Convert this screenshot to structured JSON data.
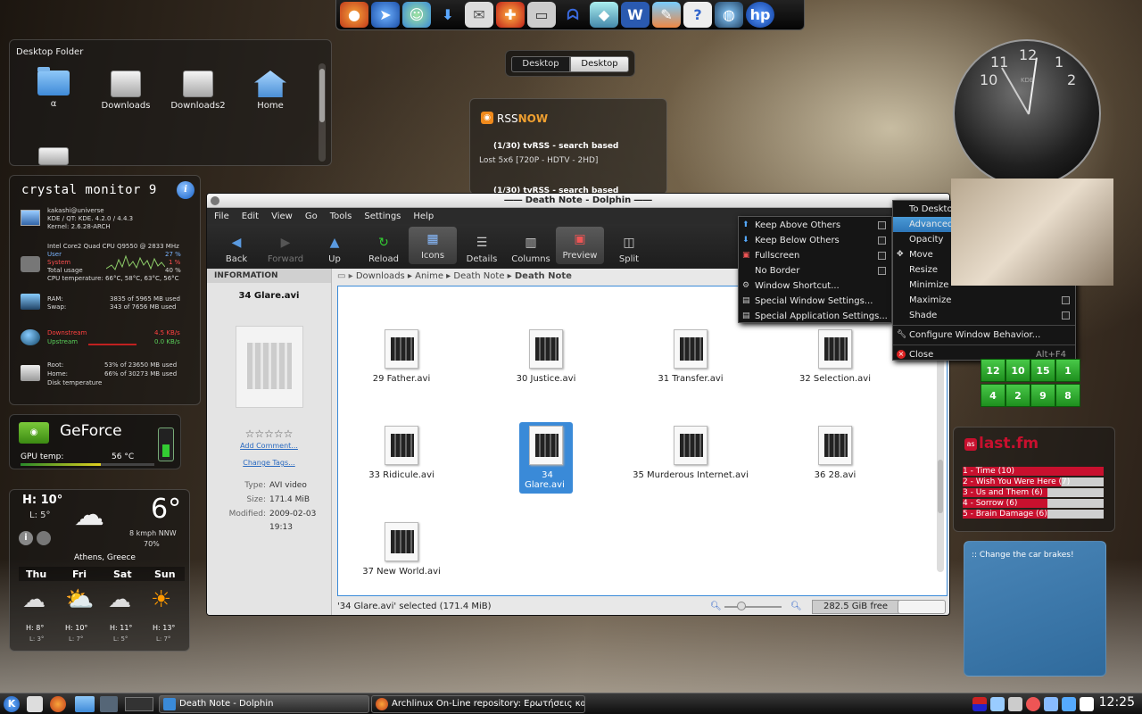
{
  "dock": {
    "icons": [
      "firefox-icon",
      "compass-icon",
      "messenger-icon",
      "download-icon",
      "mail-icon",
      "rescue-icon",
      "monitor-icon",
      "pacman-icon",
      "cube-icon",
      "word-icon",
      "paint-icon",
      "help-icon",
      "globe-icon",
      "hp-icon"
    ]
  },
  "desktop_folder": {
    "title": "Desktop Folder",
    "items": [
      {
        "label": "α"
      },
      {
        "label": "Downloads"
      },
      {
        "label": "Downloads2"
      },
      {
        "label": "Home"
      }
    ]
  },
  "activity_switcher": {
    "tabs": [
      "Desktop",
      "Desktop"
    ]
  },
  "rss": {
    "title_a": "RSS",
    "title_b": "NOW",
    "items": [
      "(1/30) tvRSS - search based",
      "Lost 5x6 [720P - HDTV - 2HD]",
      "(1/30) tvRSS - search based"
    ]
  },
  "crystal": {
    "title": "crystal monitor 9",
    "info_icon": "i",
    "user": "kakashi@universe",
    "kde": "KDE / QT: KDE. 4.2.0 / 4.4.3",
    "kernel": "Kernel: 2.6.28-ARCH",
    "cpu": "Intel Core2 Quad CPU Q9550 @ 2833 MHz",
    "cpu_user": "User",
    "cpu_user_v": "27 %",
    "cpu_system": "System",
    "cpu_system_v": "1 %",
    "cpu_total": "Total usage",
    "cpu_total_v": "40 %",
    "cpu_temp": "CPU temperature: 66°C, 58°C, 63°C, 56°C",
    "ram": "RAM:",
    "ram_v": "3835 of 5965 MB used",
    "swap": "Swap:",
    "swap_v": "343 of 7656 MB used",
    "down": "Downstream",
    "down_v": "4.5 KB/s",
    "up": "Upstream",
    "up_v": "0.0 KB/s",
    "root": "Root:",
    "root_v": "53% of 23650 MB used",
    "home": "Home:",
    "home_v": "66% of 30273 MB used",
    "disk_temp": "Disk temperature"
  },
  "geforce": {
    "title": "GeForce",
    "gpu_label": "GPU temp:",
    "gpu_value": "56 °C"
  },
  "weather": {
    "high": "H: 10°",
    "low": "L: 5°",
    "temp": "6°",
    "wind": "8 kmph NNW",
    "humidity": "70%",
    "location": "Athens, Greece",
    "days": [
      {
        "day": "Thu",
        "h": "H: 8°",
        "l": "L: 3°"
      },
      {
        "day": "Fri",
        "h": "H: 10°",
        "l": "L: 7°"
      },
      {
        "day": "Sat",
        "h": "H: 11°",
        "l": "L: 5°"
      },
      {
        "day": "Sun",
        "h": "H: 13°",
        "l": "L: 7°"
      }
    ]
  },
  "window": {
    "title": "Death Note - Dolphin",
    "menu": [
      "File",
      "Edit",
      "View",
      "Go",
      "Tools",
      "Settings",
      "Help"
    ],
    "toolbar": [
      "Back",
      "Forward",
      "Up",
      "Reload",
      "Icons",
      "Details",
      "Columns",
      "Preview",
      "Split"
    ],
    "info_header": "INFORMATION",
    "info_name": "34 Glare.avi",
    "rating": "☆☆☆☆☆",
    "add_comment": "Add Comment...",
    "change_tags": "Change Tags...",
    "type_label": "Type:",
    "type_value": "AVI video",
    "size_label": "Size:",
    "size_value": "171.4 MiB",
    "modified_label": "Modified:",
    "modified_value": "2009-02-03",
    "modified_time": "19:13",
    "breadcrumb": [
      "Downloads",
      "Anime",
      "Death Note",
      "Death Note"
    ],
    "files": [
      "29 Father.avi",
      "30 Justice.avi",
      "31 Transfer.avi",
      "32 Selection.avi",
      "33 Ridicule.avi",
      "34 Glare.avi",
      "35 Murderous Internet.avi",
      "36 28.avi",
      "37 New World.avi"
    ],
    "status": "'34 Glare.avi' selected (171.4 MiB)",
    "free": "282.5 GiB free"
  },
  "advanced_menu": {
    "items": [
      "Keep Above Others",
      "Keep Below Others",
      "Fullscreen",
      "No Border",
      "Window Shortcut...",
      "Special Window Settings...",
      "Special Application Settings..."
    ]
  },
  "window_menu": {
    "items": [
      "To Desktop",
      "Advanced",
      "Opacity",
      "Move",
      "Resize",
      "Minimize",
      "Maximize",
      "Shade",
      "Configure Window Behavior...",
      "Close"
    ],
    "close_shortcut": "Alt+F4"
  },
  "clock": {
    "numbers": [
      "12",
      "1",
      "2",
      "11",
      "10"
    ],
    "brand": "KDE"
  },
  "grid_widget": {
    "cells": [
      "12",
      "10",
      "15",
      "1",
      "4",
      "2",
      "9",
      "8"
    ]
  },
  "lastfm": {
    "title": "last.fm",
    "tracks": [
      "1 - Time (10)",
      "2 - Wish You Were Here (7)",
      "3 - Us and Them (6)",
      "4 - Sorrow (6)",
      "5 - Brain Damage (6)"
    ],
    "fill": [
      1.0,
      0.7,
      0.6,
      0.6,
      0.6
    ]
  },
  "note": {
    "text": ":: Change the car brakes!"
  },
  "taskbar": {
    "tasks": [
      "Death Note - Dolphin",
      "Archlinux On-Line repository: Ερωτήσεις κα"
    ],
    "time": "12:25"
  }
}
